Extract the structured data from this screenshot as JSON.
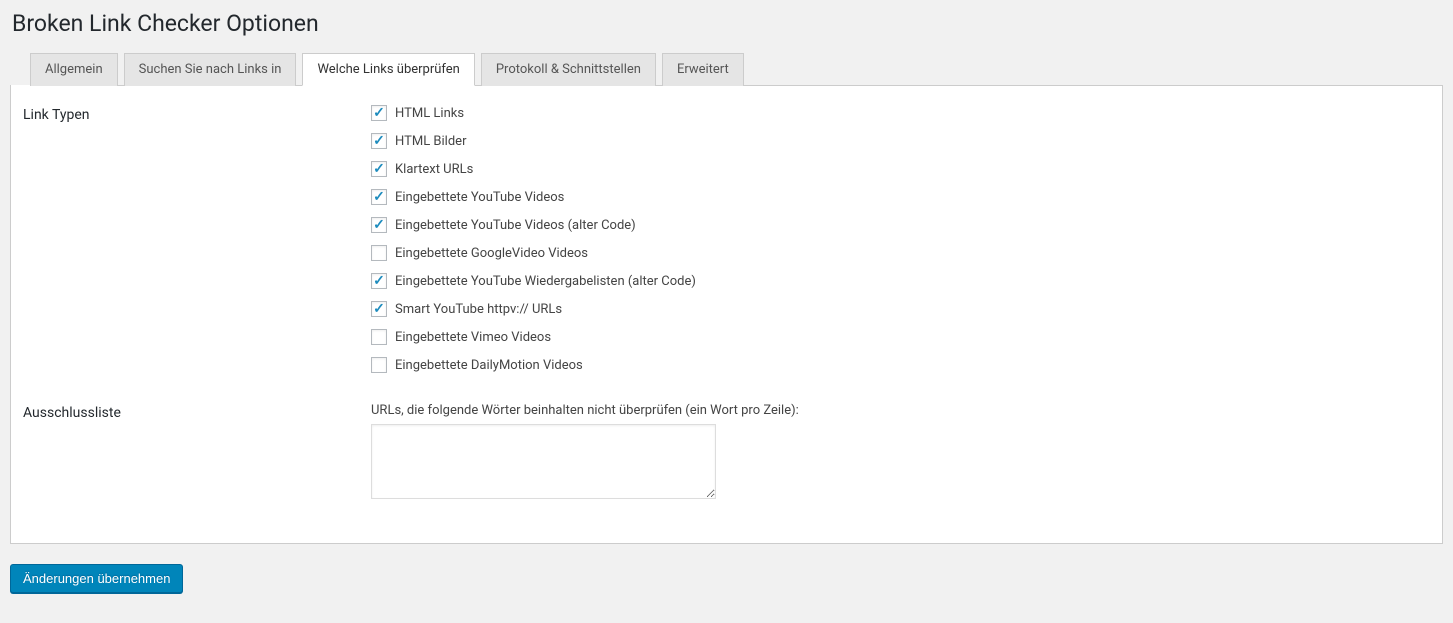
{
  "header": {
    "title": "Broken Link Checker Optionen"
  },
  "tabs": [
    {
      "id": "general",
      "label": "Allgemein",
      "active": false
    },
    {
      "id": "lookfor",
      "label": "Suchen Sie nach Links in",
      "active": false
    },
    {
      "id": "which",
      "label": "Welche Links überprüfen",
      "active": true
    },
    {
      "id": "protocol",
      "label": "Protokoll & Schnittstellen",
      "active": false
    },
    {
      "id": "advanced",
      "label": "Erweitert",
      "active": false
    }
  ],
  "sections": {
    "linkTypes": {
      "heading": "Link Typen",
      "items": [
        {
          "id": "html-links",
          "label": "HTML Links",
          "checked": true
        },
        {
          "id": "html-images",
          "label": "HTML Bilder",
          "checked": true
        },
        {
          "id": "plaintext-urls",
          "label": "Klartext URLs",
          "checked": true
        },
        {
          "id": "youtube-embed",
          "label": "Eingebettete YouTube Videos",
          "checked": true
        },
        {
          "id": "youtube-embed-old",
          "label": "Eingebettete YouTube Videos (alter Code)",
          "checked": true
        },
        {
          "id": "googlevideo",
          "label": "Eingebettete GoogleVideo Videos",
          "checked": false
        },
        {
          "id": "youtube-playlists-old",
          "label": "Eingebettete YouTube Wiedergabelisten (alter Code)",
          "checked": true
        },
        {
          "id": "smart-youtube",
          "label": "Smart YouTube httpv:// URLs",
          "checked": true
        },
        {
          "id": "vimeo",
          "label": "Eingebettete Vimeo Videos",
          "checked": false
        },
        {
          "id": "dailymotion",
          "label": "Eingebettete DailyMotion Videos",
          "checked": false
        }
      ]
    },
    "exclusion": {
      "heading": "Ausschlussliste",
      "description": "URLs, die folgende Wörter beinhalten nicht überprüfen (ein Wort pro Zeile):",
      "value": ""
    }
  },
  "actions": {
    "submit_label": "Änderungen übernehmen"
  }
}
